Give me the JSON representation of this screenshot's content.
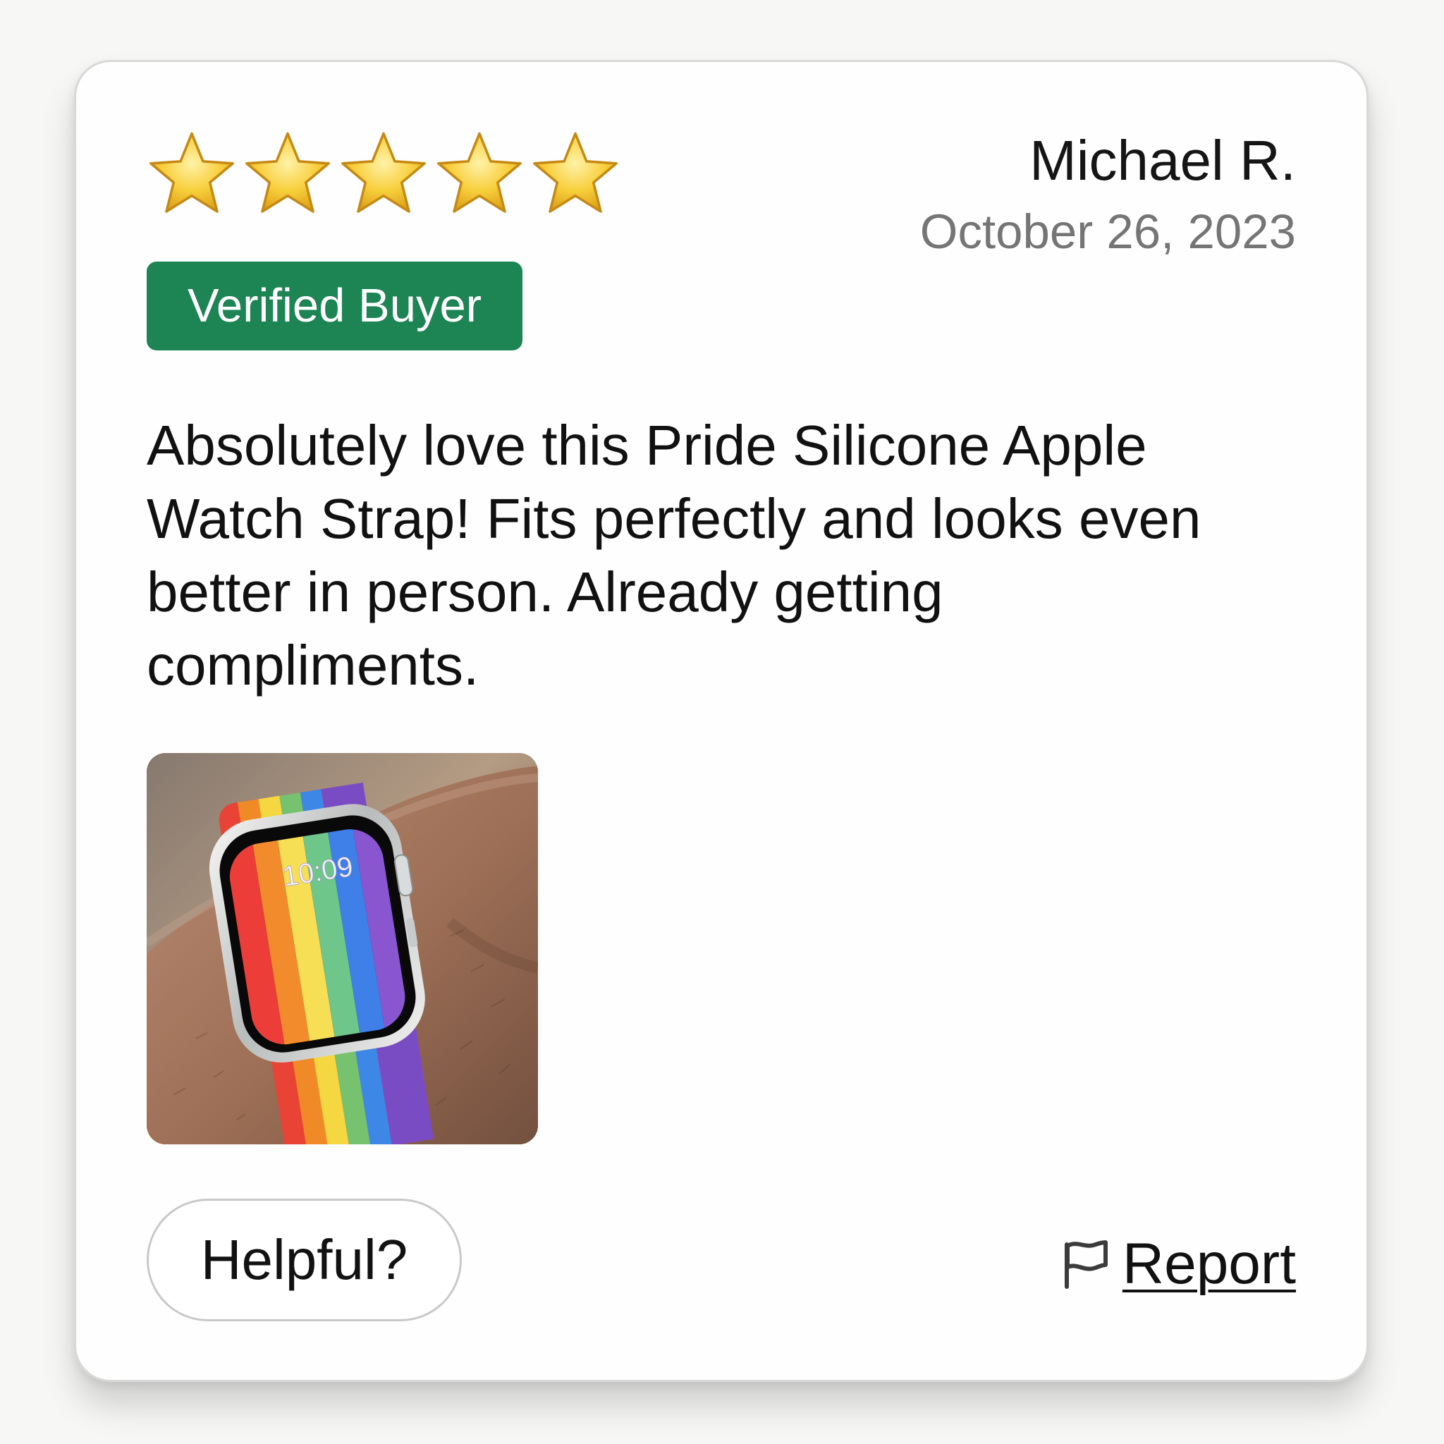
{
  "review": {
    "rating": 5,
    "max_rating": 5,
    "reviewer_name": "Michael R.",
    "date": "October 26, 2023",
    "badge": "Verified Buyer",
    "body": "Absolutely love this Pride Silicone Apple Watch Strap! Fits perfectly and looks even better in person. Already getting compliments.",
    "photo": {
      "watch_time": "10:09"
    },
    "helpful_button": "Helpful?",
    "report_label": "Report"
  },
  "colors": {
    "verified_badge": "#1d8454",
    "star": "#f4c331",
    "date_text": "#757575"
  },
  "icons": {
    "star": "star-icon",
    "report": "flag-icon"
  }
}
